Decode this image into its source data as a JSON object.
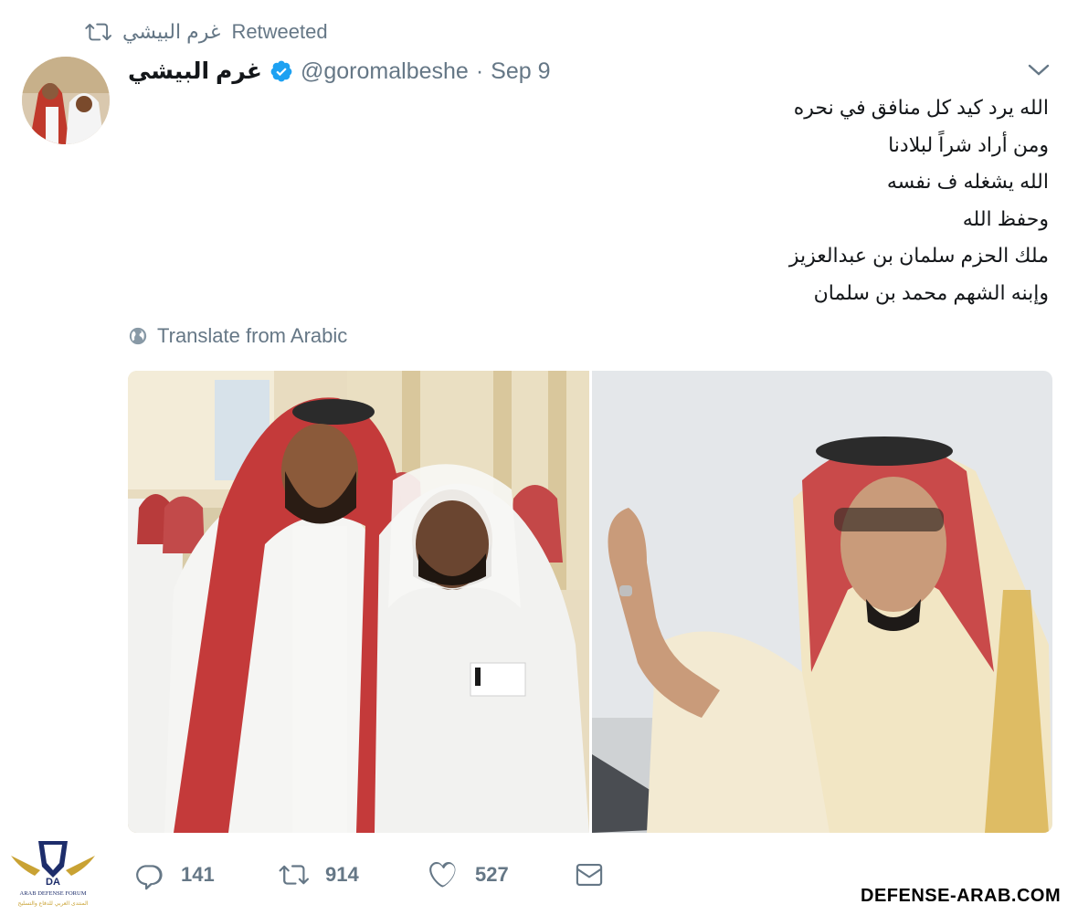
{
  "retweet": {
    "icon": "retweet-icon",
    "name": "غرم البيشي",
    "label": "Retweeted"
  },
  "tweet": {
    "display_name": "غرم البيشي",
    "verified_icon": "verified-badge-icon",
    "handle": "@goromalbeshe",
    "separator": "·",
    "date": "Sep 9",
    "menu_icon": "chevron-down-icon",
    "lines": [
      "الله يرد كيد كل منافق في نحره",
      "ومن أراد شراً لبلادنا",
      "الله يشغله ف نفسه",
      "وحفظ الله",
      "ملك الحزم سلمان بن عبدالعزيز",
      "وإبنه الشهم محمد بن سلمان"
    ],
    "translate_icon": "globe-icon",
    "translate_label": "Translate from Arabic"
  },
  "actions": {
    "reply_icon": "reply-icon",
    "reply_count": "141",
    "retweet_icon": "retweet-icon",
    "retweet_count": "914",
    "like_icon": "heart-icon",
    "like_count": "527",
    "dm_icon": "envelope-icon"
  },
  "watermark": {
    "logo_line1": "ARAB DEFENSE FORUM",
    "logo_line2": "المنتدى العربي للدفاع والتسليح",
    "site": "DEFENSE-ARAB.COM"
  },
  "colors": {
    "accent": "#1da1f2",
    "muted": "#657786",
    "text": "#14171a",
    "retweet_green": "#17bf63"
  }
}
